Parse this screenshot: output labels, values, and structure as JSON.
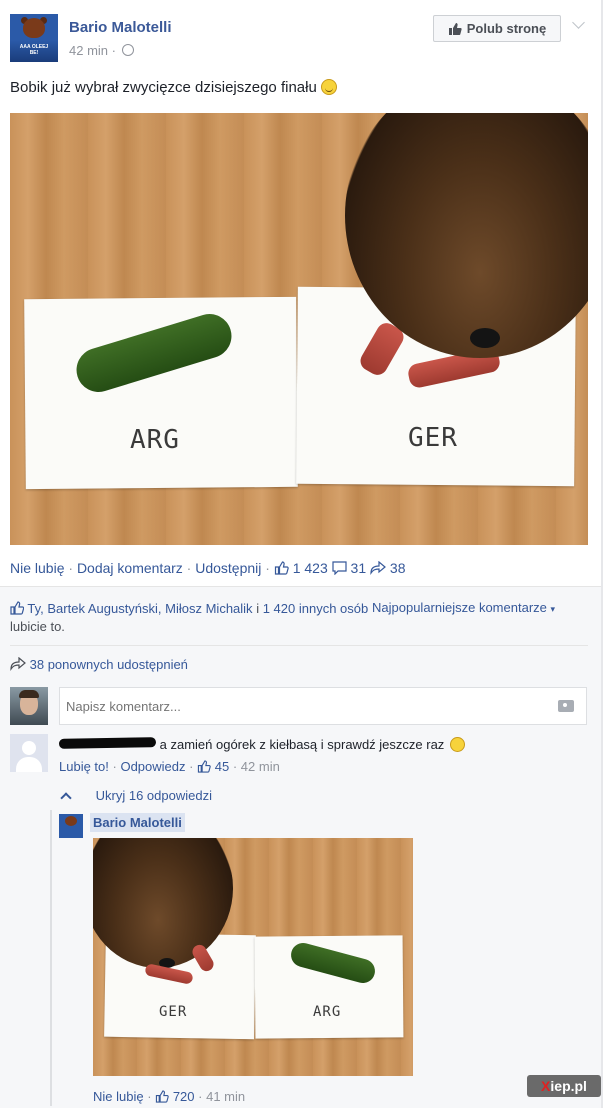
{
  "post": {
    "page_name": "Bario Malotelli",
    "time": "42 min",
    "time_sep": "·",
    "like_page_button": "Polub stronę",
    "text": "Bobik już wybrał zwycięzce dzisiejszego finału",
    "photo_labels": {
      "left": "ARG",
      "right": "GER"
    },
    "avatar_text": "AAA OLEEJ BE!"
  },
  "actions": {
    "unlike": "Nie lubię",
    "sep": "·",
    "comment": "Dodaj komentarz",
    "share": "Udostępnij",
    "like_count": "1 423",
    "comment_count": "31",
    "share_count": "38"
  },
  "likes": {
    "names": "Ty, Bartek Augustyński, Miłosz Michalik",
    "and": "i",
    "others": "1 420 innych osób",
    "suffix": "lubicie to."
  },
  "sort_label": "Najpopularniejsze komentarze",
  "shares_text": "38 ponownych udostępnień",
  "comment_input": {
    "placeholder": "Napisz komentarz..."
  },
  "comment1": {
    "text": "a zamień ogórek z kiełbasą i sprawdź jeszcze raz",
    "like": "Lubię to!",
    "sep": "·",
    "reply": "Odpowiedz",
    "likes": "45",
    "time": "42 min"
  },
  "replies_toggle": "Ukryj 16 odpowiedzi",
  "reply": {
    "author": "Bario Malotelli",
    "photo_labels": {
      "left": "GER",
      "right": "ARG"
    },
    "unlike": "Nie lubię",
    "sep": "·",
    "likes": "720",
    "time": "41 min"
  },
  "watermark": {
    "x": "X",
    "rest": "iep.pl"
  },
  "colors": {
    "link": "#365899",
    "brand": "#3b5998",
    "muted": "#90949c"
  }
}
